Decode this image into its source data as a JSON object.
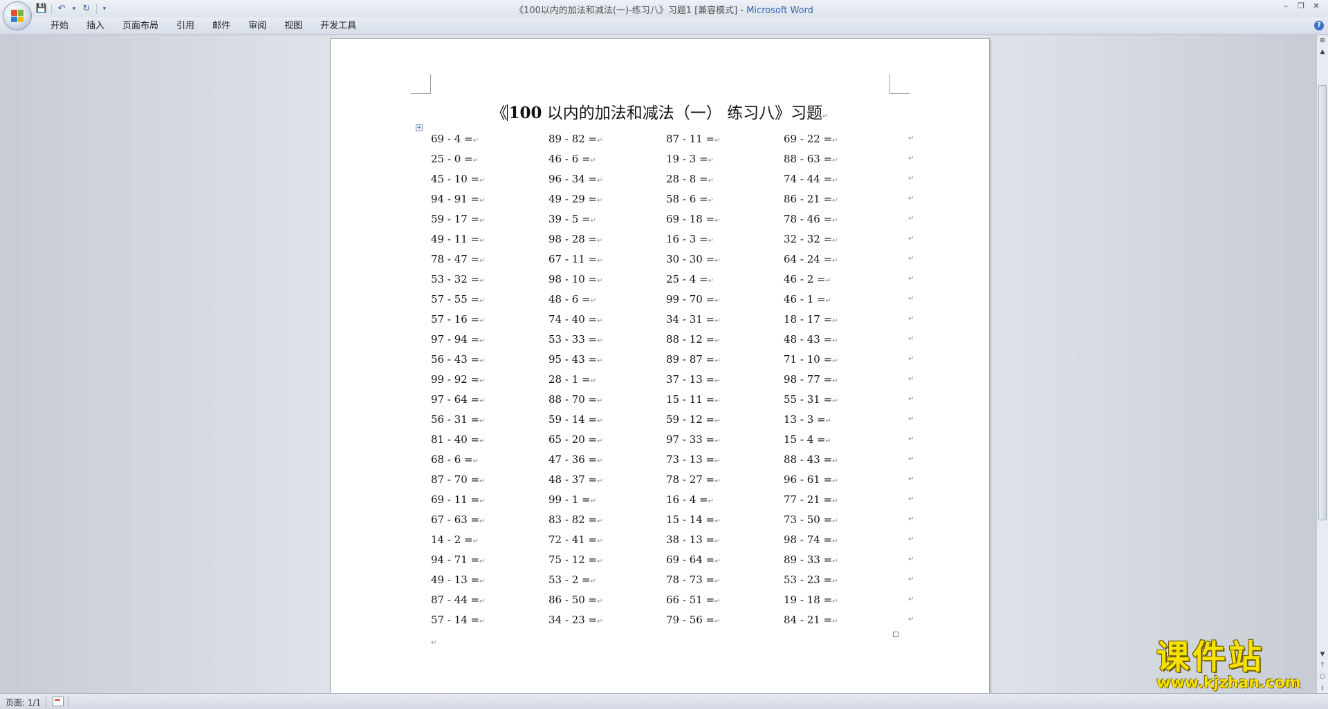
{
  "window": {
    "title": "《100以内的加法和减法(一)-练习八》习题1 [兼容模式] - ",
    "app_name": "Microsoft Word",
    "minimize": "–",
    "restore": "❐",
    "close": "✕"
  },
  "qat": {
    "save": "💾",
    "undo": "↶",
    "undo_drop": "▾",
    "redo": "↻",
    "customize": "▾"
  },
  "ribbon": {
    "tabs": [
      "开始",
      "插入",
      "页面布局",
      "引用",
      "邮件",
      "审阅",
      "视图",
      "开发工具"
    ],
    "help": "?"
  },
  "document": {
    "title_open": "《",
    "title_num": "100",
    "title_rest": " 以内的加法和减法（一） 练习八》习题",
    "paragraph_mark": "↵",
    "table_handle": "+",
    "rows": [
      [
        "69 - 4 =",
        "89 - 82 =",
        "87 - 11 =",
        "69 - 22 ="
      ],
      [
        "25 - 0 =",
        "46 - 6 =",
        "19 - 3 =",
        "88 - 63 ="
      ],
      [
        "45 - 10 =",
        "96 - 34 =",
        "28 - 8 =",
        "74 - 44 ="
      ],
      [
        "94 - 91 =",
        "49 - 29 =",
        "58 - 6 =",
        "86 - 21 ="
      ],
      [
        "59 - 17 =",
        "39 - 5 =",
        "69 - 18 =",
        "78 - 46 ="
      ],
      [
        "49 - 11 =",
        "98 - 28 =",
        "16 - 3 =",
        "32 - 32 ="
      ],
      [
        "78 - 47 =",
        "67 - 11 =",
        "30 - 30 =",
        "64 - 24 ="
      ],
      [
        "53 - 32 =",
        "98 - 10 =",
        "25 - 4 =",
        "46 - 2 ="
      ],
      [
        "57 - 55 =",
        "48 - 6 =",
        "99 - 70 =",
        "46 - 1 ="
      ],
      [
        "57 - 16 =",
        "74 - 40 =",
        "34 - 31 =",
        "18 - 17 ="
      ],
      [
        "97 - 94 =",
        "53 - 33 =",
        "88 - 12 =",
        "48 - 43 ="
      ],
      [
        "56 - 43 =",
        "95 - 43 =",
        "89 - 87 =",
        "71 - 10 ="
      ],
      [
        "99 - 92 =",
        "28 - 1 =",
        "37 - 13 =",
        "98 - 77 ="
      ],
      [
        "97 - 64 =",
        "88 - 70 =",
        "15 - 11 =",
        "55 - 31 ="
      ],
      [
        "56 - 31 =",
        "59 - 14 =",
        "59 - 12 =",
        "13 - 3 ="
      ],
      [
        "81 - 40 =",
        "65 - 20 =",
        "97 - 33 =",
        "15 - 4 ="
      ],
      [
        "68 - 6 =",
        "47 - 36 =",
        "73 - 13 =",
        "88 - 43 ="
      ],
      [
        "87 - 70 =",
        "48 - 37 =",
        "78 - 27 =",
        "96 - 61 ="
      ],
      [
        "69 - 11 =",
        "99 - 1 =",
        "16 - 4 =",
        "77 - 21 ="
      ],
      [
        "67 - 63 =",
        "83 - 82 =",
        "15 - 14 =",
        "73 - 50 ="
      ],
      [
        "14 - 2 =",
        "72 - 41 =",
        "38 - 13 =",
        "98 - 74 ="
      ],
      [
        "94 - 71 =",
        "75 - 12 =",
        "69 - 64 =",
        "89 - 33 ="
      ],
      [
        "49 - 13 =",
        "53 - 2 =",
        "78 - 73 =",
        "53 - 23 ="
      ],
      [
        "87 - 44 =",
        "86 - 50 =",
        "66 - 51 =",
        "19 - 18 ="
      ],
      [
        "57 - 14 =",
        "34 - 23 =",
        "79 - 56 =",
        "84 - 21 ="
      ]
    ]
  },
  "scrollbar": {
    "up": "▲",
    "ruler": "⊞",
    "down": "▼",
    "prev": "⤒",
    "select": "○",
    "next": "⤓"
  },
  "status": {
    "page": "页面: 1/1"
  },
  "watermark": {
    "cn": "课件站",
    "url": "www.kjzhan.com"
  }
}
